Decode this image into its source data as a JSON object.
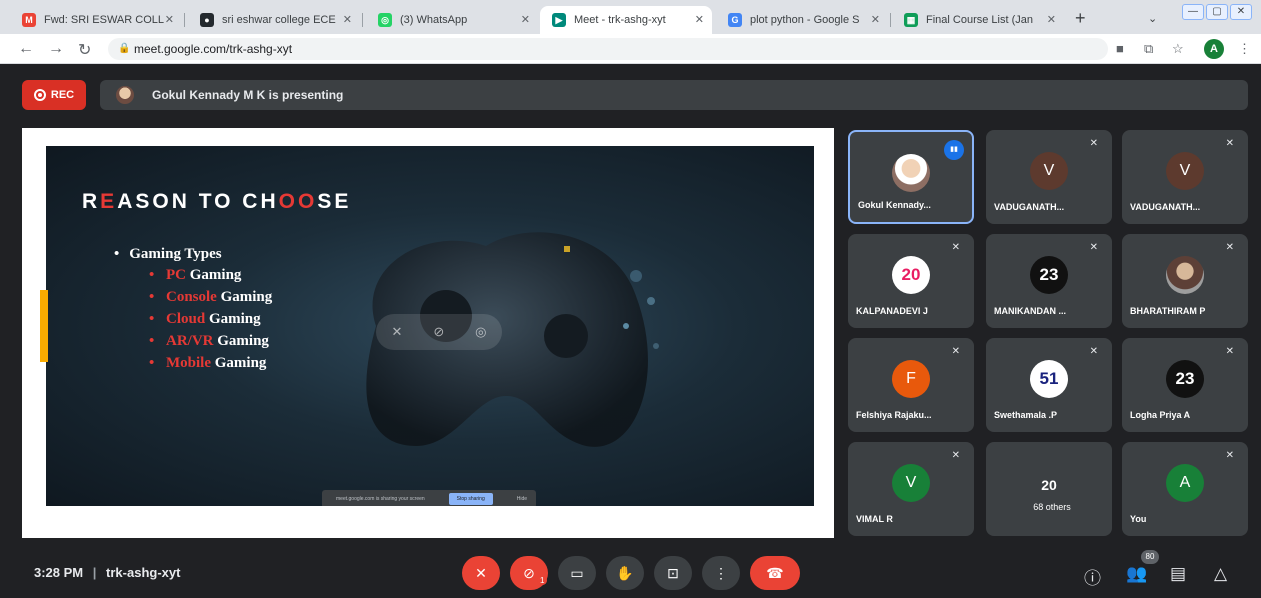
{
  "browser": {
    "tabs": [
      {
        "title": "Fwd: SRI ESWAR COLL",
        "favicon": "gmail-icon",
        "color": "#ea4335",
        "glyph": "M"
      },
      {
        "title": "sri eshwar college ECE",
        "favicon": "github-icon",
        "color": "#24292e",
        "glyph": "●"
      },
      {
        "title": "(3) WhatsApp",
        "favicon": "whatsapp-icon",
        "color": "#25d366",
        "glyph": "◎"
      },
      {
        "title": "Meet - trk-ashg-xyt",
        "favicon": "meet-icon",
        "color": "#00897b",
        "glyph": "▶"
      },
      {
        "title": "plot python - Google S",
        "favicon": "google-icon",
        "color": "#4285f4",
        "glyph": "G"
      },
      {
        "title": "Final Course List (Jan",
        "favicon": "sheets-icon",
        "color": "#0f9d58",
        "glyph": "▦"
      }
    ],
    "url": "meet.google.com/trk-ashg-xyt",
    "profile_initial": "A"
  },
  "meeting": {
    "rec_label": "REC",
    "presenting_text": "Gokul Kennady M K is presenting",
    "code": "trk-ashg-xyt",
    "time": "3:28 PM",
    "separator": "|",
    "participant_count": "80",
    "camera_badge": "1"
  },
  "slide": {
    "title_parts": [
      {
        "t": "R",
        "red": false
      },
      {
        "t": "E",
        "red": true
      },
      {
        "t": "ASON TO CH",
        "red": false
      },
      {
        "t": "OO",
        "red": true
      },
      {
        "t": "SE",
        "red": false
      }
    ],
    "heading": "Gaming Types",
    "items": [
      {
        "hl": "PC",
        "rest": " Gaming"
      },
      {
        "hl": "Console",
        "rest": " Gaming"
      },
      {
        "hl": "Cloud",
        "rest": " Gaming"
      },
      {
        "hl": "AR/VR",
        "rest": " Gaming"
      },
      {
        "hl": "Mobile",
        "rest": " Gaming"
      }
    ],
    "share_text": "meet.google.com is sharing your screen",
    "stop_label": "Stop sharing",
    "hide_label": "Hide"
  },
  "tiles": [
    {
      "name": "Gokul Kennady...",
      "type": "photo",
      "speaking": true
    },
    {
      "name": "VADUGANATH...",
      "type": "letter",
      "letter": "V",
      "color": "#5d3a2e"
    },
    {
      "name": "VADUGANATH...",
      "type": "letter",
      "letter": "V",
      "color": "#5d3a2e"
    },
    {
      "name": "KALPANADEVI J",
      "type": "badge",
      "letter": "20",
      "color": "#ffffff",
      "textColor": "#e91e63"
    },
    {
      "name": "MANIKANDAN ...",
      "type": "badge",
      "letter": "23",
      "color": "#111111",
      "textColor": "#ffffff"
    },
    {
      "name": "BHARATHIRAM P",
      "type": "photo2"
    },
    {
      "name": "Felshiya Rajaku...",
      "type": "letter",
      "letter": "F",
      "color": "#e8590c"
    },
    {
      "name": "Swethamala .P",
      "type": "badge",
      "letter": "51",
      "color": "#ffffff",
      "textColor": "#1a237e"
    },
    {
      "name": "Logha Priya A",
      "type": "badge",
      "letter": "23",
      "color": "#111111",
      "textColor": "#ffffff"
    },
    {
      "name": "VIMAL R",
      "type": "letter",
      "letter": "V",
      "color": "#188038"
    },
    {
      "name": "68 others",
      "type": "others",
      "letter": "20"
    },
    {
      "name": "You",
      "type": "letter",
      "letter": "A",
      "color": "#188038"
    }
  ]
}
